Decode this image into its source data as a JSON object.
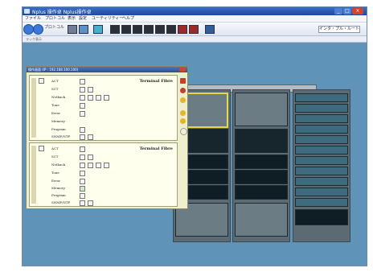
{
  "window": {
    "title": "Nplus 操作卓 Nplus操作卓"
  },
  "menu": [
    "ファイル",
    "プロトコル",
    "表示",
    "設定",
    "ユーティリティー",
    "ヘルプ"
  ],
  "toolbar": {
    "label": "プロトコル",
    "right_field": "インタ・プル・ルート"
  },
  "subbar": {
    "text": "ラック表示"
  },
  "panel": {
    "title": "操作画面 (IP : 192.168.100.100)",
    "sections": [
      {
        "title": "Terminal Fibre",
        "rows": [
          "ACT",
          "SCT",
          "Netback",
          "Tone",
          "Error",
          "Memory",
          "Program",
          "SNMP/NTP"
        ]
      },
      {
        "title": "Terminal Fibre",
        "rows": [
          "ACT",
          "SCT",
          "Netback",
          "Tone",
          "Error",
          "Memory",
          "Program",
          "SNMP/NTP"
        ]
      }
    ]
  },
  "icons": {
    "nav_back": "back-arrow-icon",
    "nav_forward": "forward-arrow-icon",
    "toolbar": [
      "rack-icon",
      "device-icon",
      "save-icon",
      "monitor-icon",
      "monitor-icon",
      "monitor-icon",
      "monitor-icon",
      "monitor-icon",
      "monitor-icon",
      "alarm-icon",
      "alarm-icon",
      "export-icon"
    ]
  }
}
